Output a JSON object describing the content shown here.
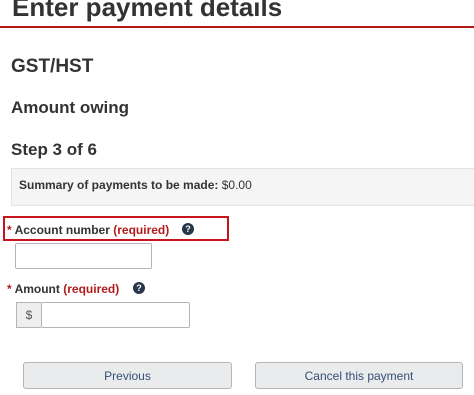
{
  "page": {
    "title": "Enter payment details",
    "tax_type": "GST/HST",
    "section": "Amount owing",
    "step": "Step 3 of 6"
  },
  "summary": {
    "label": "Summary of payments to be made:",
    "value": "$0.00"
  },
  "account_field": {
    "asterisk": "*",
    "label": "Account number",
    "required": "(required)",
    "help_icon": "question-circle-icon",
    "value": ""
  },
  "amount_field": {
    "asterisk": "*",
    "label": "Amount",
    "required": "(required)",
    "help_icon": "question-circle-icon",
    "currency": "$",
    "value": ""
  },
  "buttons": {
    "previous": "Previous",
    "cancel": "Cancel this payment"
  },
  "colors": {
    "accent_red": "#b31b1b",
    "highlight_border": "#c8141e",
    "help_icon_bg": "#26374a",
    "button_text": "#335075"
  }
}
